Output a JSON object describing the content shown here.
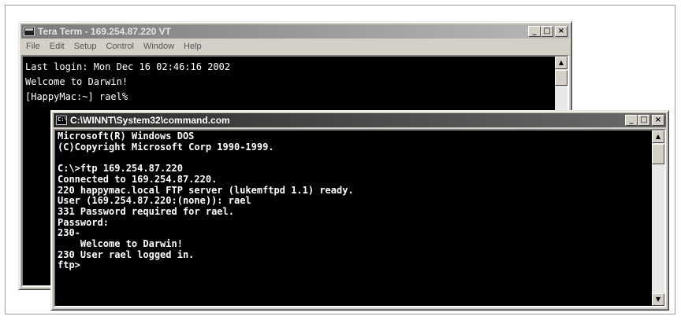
{
  "tera_term": {
    "title": "Tera Term - 169.254.87.220 VT",
    "menu": [
      "File",
      "Edit",
      "Setup",
      "Control",
      "Window",
      "Help"
    ],
    "lines": [
      "Last login: Mon Dec 16 02:46:16 2002",
      "Welcome to Darwin!",
      "[HappyMac:~] rael%"
    ]
  },
  "cmd": {
    "title": "C:\\WINNT\\System32\\command.com",
    "lines": [
      "Microsoft(R) Windows DOS",
      "(C)Copyright Microsoft Corp 1990-1999.",
      "",
      "C:\\>ftp 169.254.87.220",
      "Connected to 169.254.87.220.",
      "220 happymac.local FTP server (lukemftpd 1.1) ready.",
      "User (169.254.87.220:(none)): rael",
      "331 Password required for rael.",
      "Password:",
      "230-",
      "    Welcome to Darwin!",
      "230 User rael logged in.",
      "ftp>"
    ]
  },
  "buttons": {
    "minimize": "_",
    "maximize": "□",
    "close": "×"
  },
  "icons": {
    "tera_term": "terminal-app-icon",
    "cmd": "command-prompt-icon",
    "scroll_up": "▲",
    "scroll_down": "▼"
  }
}
